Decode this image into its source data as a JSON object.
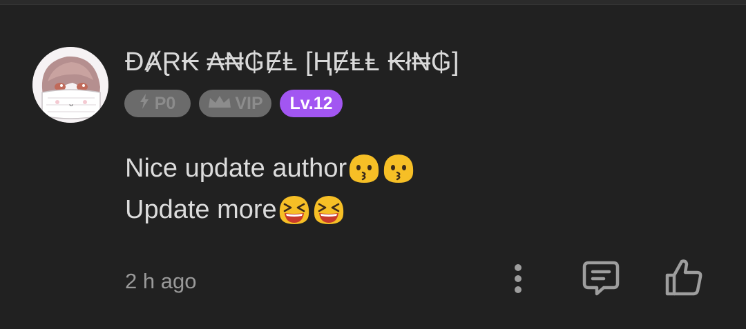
{
  "comment": {
    "username": "ĐȺⱤ₭ ₳₦₲ɆⱠ [ⱧɆⱠⱠ ₭ł₦₲]",
    "badges": {
      "p0_label": "P0",
      "vip_label": "VIP",
      "level_label": "Lv.12"
    },
    "text_lines": [
      "Nice update author",
      "Update more"
    ],
    "timestamp": "2 h ago"
  },
  "icons": {
    "more": "more-vertical-icon",
    "reply": "comment-icon",
    "like": "thumbs-up-icon",
    "p0": "lightning-icon",
    "vip": "crown-icon"
  },
  "colors": {
    "background": "#212121",
    "level_badge": "#a256f2",
    "muted_badge": "#6b6b6b",
    "text": "#dcdcdc",
    "icon": "#9e9e9e"
  }
}
